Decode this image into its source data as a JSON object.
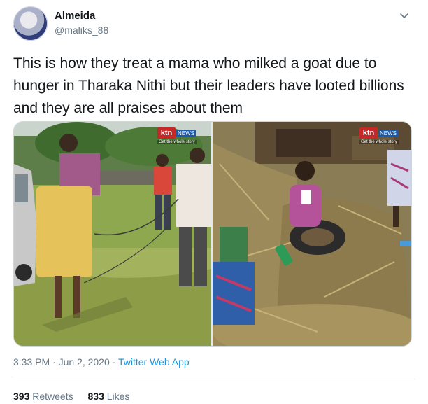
{
  "user": {
    "display_name": "Almeida",
    "handle": "@maliks_88"
  },
  "tweet": {
    "text": "This is how they treat a mama who milked a goat due to hunger in Tharaka Nithi but their leaders have looted billions and they are all praises about them"
  },
  "media": {
    "logo_text": "ktn",
    "logo_news": "NEWS",
    "logo_sub": "Get the whole story"
  },
  "meta": {
    "timestamp": "3:33 PM · Jun 2, 2020",
    "separator": " · ",
    "source": "Twitter Web App"
  },
  "stats": {
    "retweets_count": "393",
    "retweets_label": "Retweets",
    "likes_count": "833",
    "likes_label": "Likes"
  },
  "icons": {
    "caret": "chevron-down-icon"
  },
  "colors": {
    "accent": "#1b95e0",
    "secondary_text": "#657786",
    "primary_text": "#14171a"
  }
}
